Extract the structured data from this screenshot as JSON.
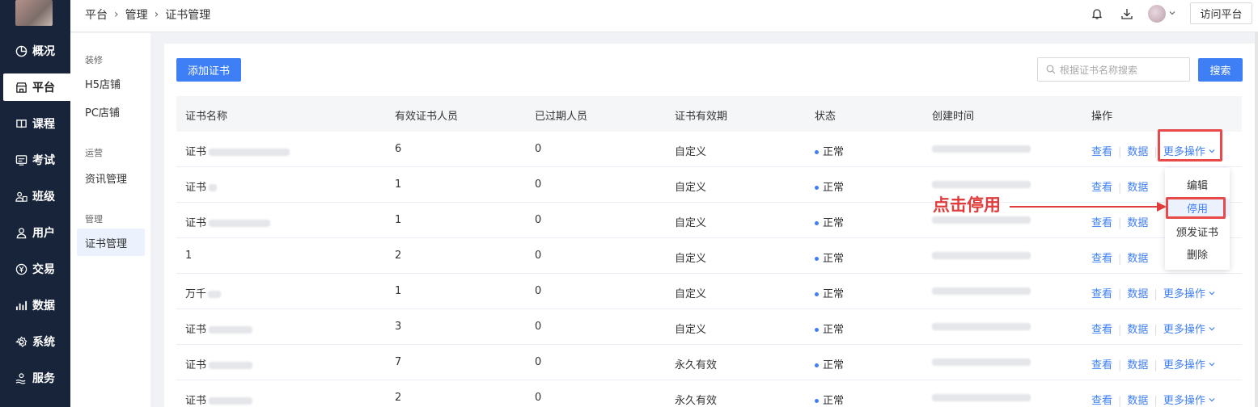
{
  "sidebar": {
    "items": [
      {
        "label": "概况",
        "icon": "pie-chart-icon"
      },
      {
        "label": "平台",
        "icon": "store-icon",
        "active": true
      },
      {
        "label": "课程",
        "icon": "book-icon"
      },
      {
        "label": "考试",
        "icon": "exam-icon"
      },
      {
        "label": "班级",
        "icon": "class-icon"
      },
      {
        "label": "用户",
        "icon": "user-icon"
      },
      {
        "label": "交易",
        "icon": "yen-icon"
      },
      {
        "label": "数据",
        "icon": "bar-chart-icon"
      },
      {
        "label": "系统",
        "icon": "gear-icon"
      },
      {
        "label": "服务",
        "icon": "service-icon"
      }
    ]
  },
  "header": {
    "breadcrumb": [
      "平台",
      "管理",
      "证书管理"
    ],
    "visit_label": "访问平台"
  },
  "submenu": {
    "groups": [
      {
        "title": "装修",
        "items": [
          "H5店铺",
          "PC店铺"
        ]
      },
      {
        "title": "运营",
        "items": [
          "资讯管理"
        ]
      },
      {
        "title": "管理",
        "items": [
          "证书管理"
        ]
      }
    ]
  },
  "toolbar": {
    "add_label": "添加证书",
    "search_placeholder": "根据证书名称搜索",
    "search_label": "搜索"
  },
  "table": {
    "columns": [
      "证书名称",
      "有效证书人员",
      "已过期人员",
      "证书有效期",
      "状态",
      "创建时间",
      "操作"
    ],
    "rows": [
      {
        "name": "证书",
        "valid": "6",
        "expired": "0",
        "period": "自定义",
        "status": "正常"
      },
      {
        "name": "证书",
        "valid": "1",
        "expired": "0",
        "period": "自定义",
        "status": "正常"
      },
      {
        "name": "证书",
        "valid": "1",
        "expired": "0",
        "period": "自定义",
        "status": "正常"
      },
      {
        "name": "1",
        "valid": "2",
        "expired": "0",
        "period": "自定义",
        "status": "正常"
      },
      {
        "name": "万千",
        "valid": "1",
        "expired": "0",
        "period": "自定义",
        "status": "正常"
      },
      {
        "name": "证书",
        "valid": "3",
        "expired": "0",
        "period": "自定义",
        "status": "正常"
      },
      {
        "name": "证书",
        "valid": "7",
        "expired": "0",
        "period": "永久有效",
        "status": "正常"
      },
      {
        "name": "证书",
        "valid": "2",
        "expired": "0",
        "period": "永久有效",
        "status": "正常"
      }
    ],
    "actions": {
      "view": "查看",
      "data": "数据",
      "more": "更多操作"
    }
  },
  "dropdown": {
    "items": [
      "编辑",
      "停用",
      "颁发证书",
      "删除"
    ],
    "selected": "停用"
  },
  "annotation": {
    "text": "点击停用"
  },
  "colors": {
    "primary": "#3f7ff6",
    "sidebar": "#18243a",
    "annotation": "#e03c3c"
  }
}
